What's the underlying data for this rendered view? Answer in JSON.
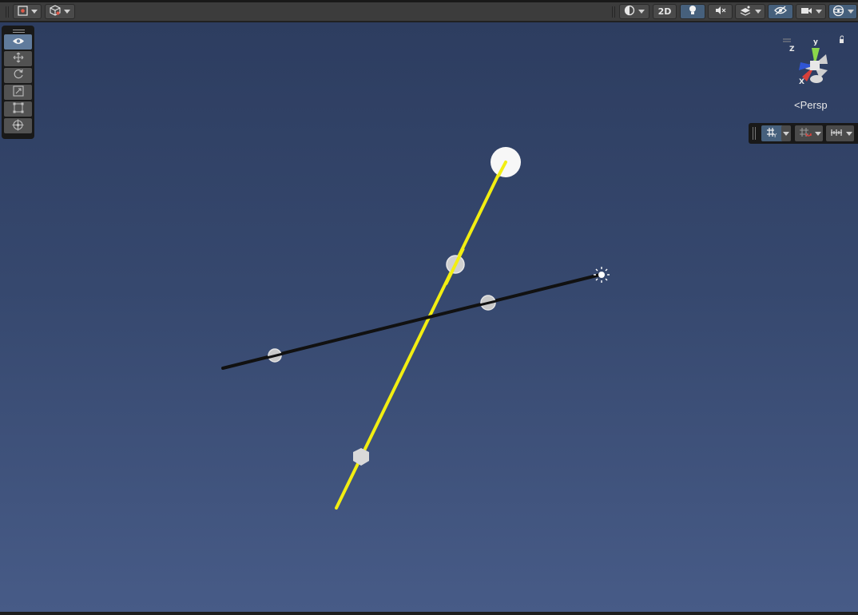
{
  "toolbar": {
    "left_buttons": [
      {
        "name": "pivot-mode-button",
        "icon": "pivot-icon"
      },
      {
        "name": "global-local-button",
        "icon": "cube-icon"
      }
    ],
    "right_buttons": [
      {
        "name": "draw-mode-button",
        "icon": "shading-sphere-icon"
      },
      {
        "name": "2d-toggle-button",
        "label": "2D"
      },
      {
        "name": "lighting-toggle-button",
        "icon": "lightbulb-icon",
        "active": true
      },
      {
        "name": "audio-toggle-button",
        "icon": "audio-mute-icon"
      },
      {
        "name": "effects-button",
        "icon": "effects-layers-icon"
      },
      {
        "name": "scene-visibility-button",
        "icon": "eye-slash-icon",
        "active": true
      },
      {
        "name": "camera-settings-button",
        "icon": "camera-icon"
      },
      {
        "name": "gizmos-button",
        "icon": "gizmo-sphere-icon",
        "active": true
      }
    ]
  },
  "tools": {
    "items": [
      {
        "name": "view-tool",
        "icon": "eye-icon",
        "active": true
      },
      {
        "name": "move-tool",
        "icon": "move-arrows-icon"
      },
      {
        "name": "rotate-tool",
        "icon": "rotate-icon"
      },
      {
        "name": "scale-tool",
        "icon": "scale-icon"
      },
      {
        "name": "rect-tool",
        "icon": "rect-transform-icon"
      },
      {
        "name": "transform-tool",
        "icon": "transform-icon"
      }
    ]
  },
  "gizmo": {
    "axis_labels": {
      "x": "X",
      "y": "y",
      "z": "Z"
    },
    "projection_label": "Persp"
  },
  "overlay_toolbar": {
    "buttons": [
      {
        "name": "grid-toggle-button",
        "icon": "grid-y-icon",
        "active": true
      },
      {
        "name": "snap-toggle-button",
        "icon": "grid-snap-icon"
      },
      {
        "name": "increment-snap-button",
        "icon": "ruler-icon"
      }
    ]
  },
  "scene": {
    "colors": {
      "yellow_line": "#f2ee12",
      "black_line": "#111111",
      "sky_top": "#2d3d60",
      "sky_bottom": "#475b87"
    }
  }
}
